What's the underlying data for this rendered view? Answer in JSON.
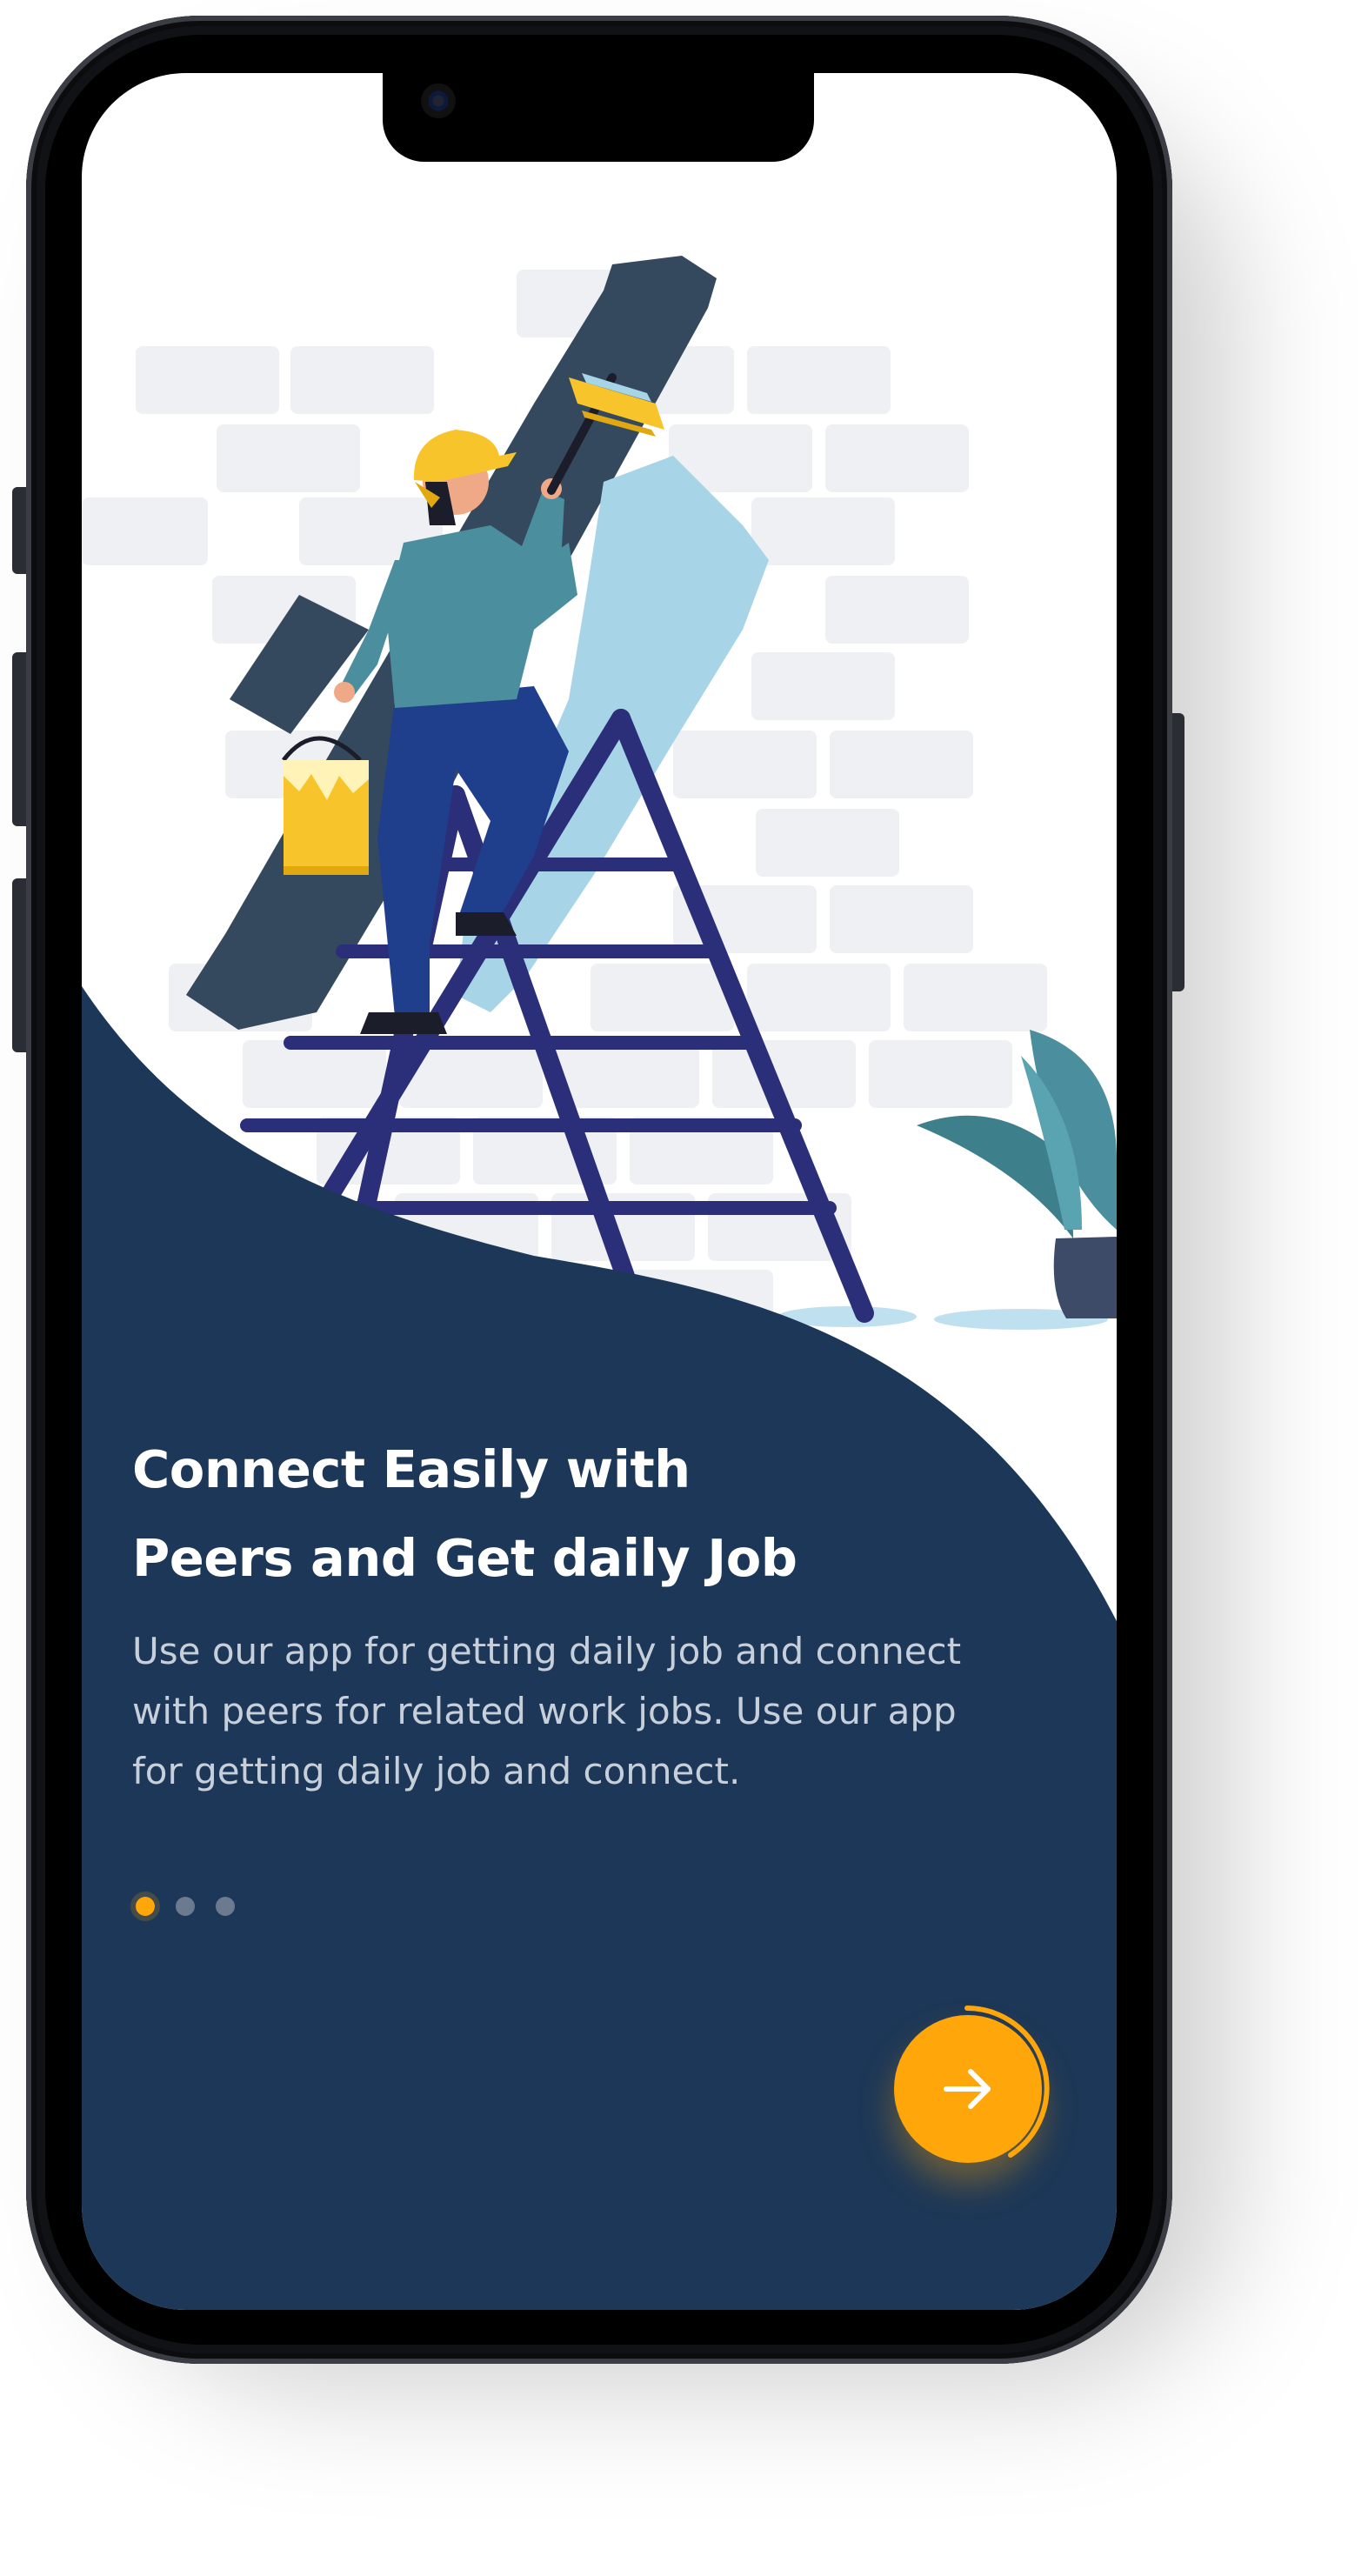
{
  "onboarding": {
    "title_lines": [
      "Connect Easily with",
      "Peers and Get daily Job"
    ],
    "description_lines": [
      "Use our app for getting daily job and connect",
      "with peers for related work jobs. Use our app",
      "for getting daily job and connect."
    ],
    "pagination": {
      "total": 3,
      "current": 1
    },
    "next_button": {
      "icon": "arrow-right-icon"
    }
  },
  "colors": {
    "panel": "#1c3757",
    "accent": "#ffa60a",
    "dot_inactive": "#6b7a8f",
    "title": "#ffffff",
    "description": "#c7cfdb"
  },
  "illustration": {
    "subject": "painter-on-ladder-illustration",
    "icons": [
      "brick-wall-icon",
      "paint-roller-icon",
      "paint-bucket-icon",
      "ladder-icon",
      "potted-plant-icon"
    ]
  }
}
